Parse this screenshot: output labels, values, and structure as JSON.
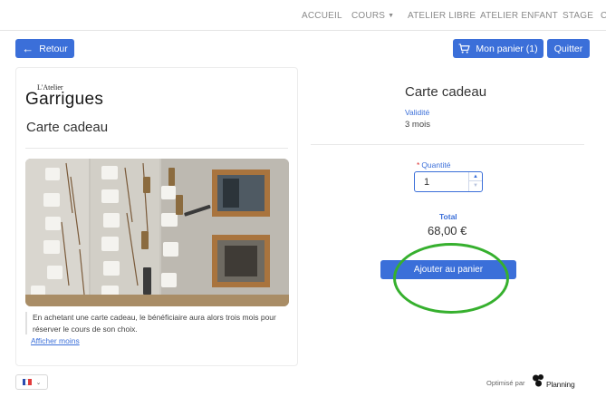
{
  "nav": {
    "items": [
      {
        "label": "ACCUEIL"
      },
      {
        "label": "COURS"
      },
      {
        "label": "ATELIER LIBRE"
      },
      {
        "label": "ATELIER ENFANT"
      },
      {
        "label": "STAGE"
      },
      {
        "label": "C"
      }
    ]
  },
  "toolbar": {
    "back_label": "Retour",
    "cart_label": "Mon panier (1)",
    "quit_label": "Quitter"
  },
  "card": {
    "logo_small": "L'Atelier",
    "logo_big": "Garrigues",
    "title": "Carte cadeau",
    "description": "En achetant une carte cadeau, le bénéficiaire aura alors trois mois pour réserver le cours de son choix.",
    "toggle_link": "Afficher moins"
  },
  "product": {
    "title": "Carte cadeau",
    "validity_label": "Validité",
    "validity_value": "3 mois",
    "quantity_required_mark": "*",
    "quantity_label": "Quantité",
    "quantity_value": "1",
    "total_label": "Total",
    "total_value": "68,00 €",
    "add_to_cart_label": "Ajouter au panier"
  },
  "footer": {
    "powered_by": "Optimisé par",
    "brand": "Planning"
  },
  "colors": {
    "accent": "#3b6fd9",
    "highlight_ring": "#36b02e",
    "flag": [
      "#2a4cb0",
      "#ffffff",
      "#e23b3b"
    ]
  },
  "icons": {
    "back": "arrow-left-icon",
    "cart": "cart-icon",
    "caret": "chevron-down-icon",
    "spinner_up": "triangle-up-icon",
    "spinner_down": "triangle-down-icon",
    "language": "french-flag-icon",
    "brand": "planning-logo-icon"
  }
}
